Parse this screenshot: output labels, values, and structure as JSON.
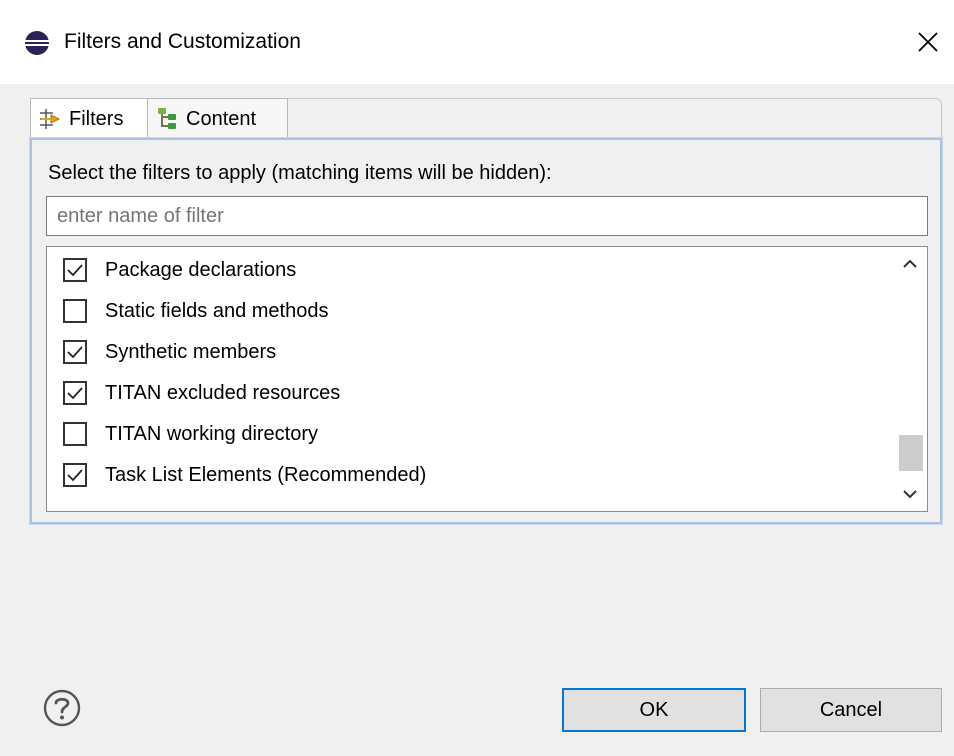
{
  "dialog": {
    "title": "Filters and Customization",
    "icon": "eclipse-icon"
  },
  "tabs": [
    {
      "label": "Filters",
      "icon": "filters-icon",
      "active": true
    },
    {
      "label": "Content",
      "icon": "content-tree-icon",
      "active": false
    }
  ],
  "filters_panel": {
    "instruction": "Select the filters to apply (matching items will be hidden):",
    "search": {
      "value": "",
      "placeholder": "enter name of filter"
    },
    "items": [
      {
        "label": "Package declarations",
        "checked": true
      },
      {
        "label": "Static fields and methods",
        "checked": false
      },
      {
        "label": "Synthetic members",
        "checked": true
      },
      {
        "label": "TITAN excluded resources",
        "checked": true
      },
      {
        "label": "TITAN working directory",
        "checked": false
      },
      {
        "label": "Task List Elements (Recommended)",
        "checked": true
      }
    ],
    "scroll_position": 0.88
  },
  "buttons": {
    "ok": "OK",
    "cancel": "Cancel",
    "help_icon": "help-icon"
  },
  "colors": {
    "accent": "#0078d7",
    "panel_border": "#a9c4de"
  }
}
